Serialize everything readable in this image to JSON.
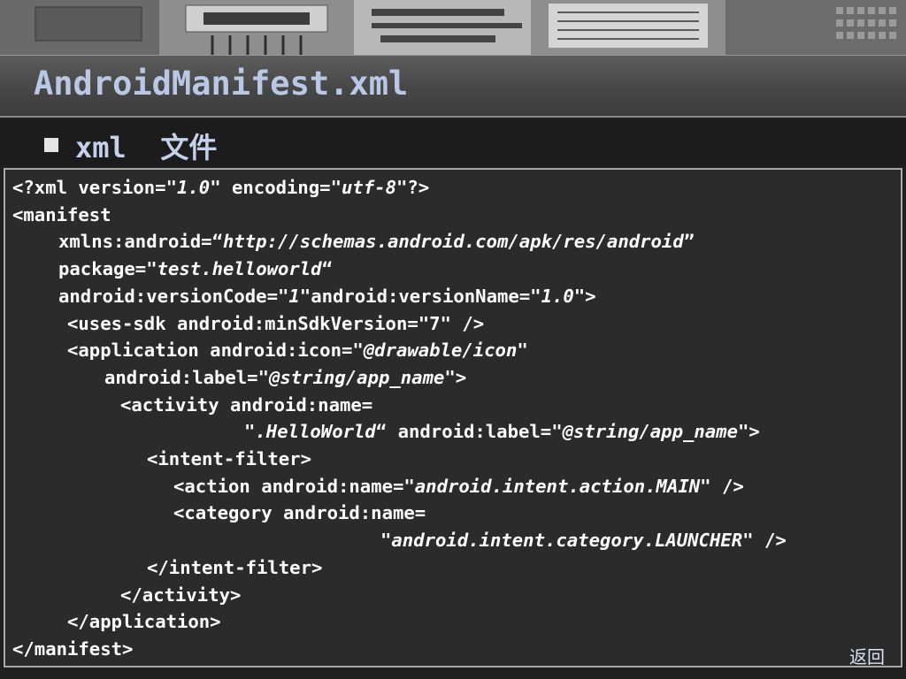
{
  "slide": {
    "title": "AndroidManifest.xml",
    "bullet": "xml  文件",
    "return_link": "返回"
  },
  "code_lines": [
    {
      "indent": 0,
      "parts": [
        [
          "<?xml version=",
          false
        ],
        [
          "\"1.0\"",
          true
        ],
        [
          " encoding=",
          false
        ],
        [
          "\"utf-8\"",
          true
        ],
        [
          "?>",
          false
        ]
      ]
    },
    {
      "indent": 0,
      "parts": [
        [
          "<manifest",
          false
        ]
      ]
    },
    {
      "indent": 52,
      "parts": [
        [
          "xmlns:android=“",
          false
        ],
        [
          "http://schemas.android.com/apk/res/android",
          true
        ],
        [
          "”",
          false
        ]
      ]
    },
    {
      "indent": 52,
      "parts": [
        [
          "package=",
          false
        ],
        [
          "\"test.helloworld",
          true
        ],
        [
          "“",
          false
        ]
      ]
    },
    {
      "indent": 52,
      "parts": [
        [
          "android:versionCode=",
          false
        ],
        [
          "\"1\"",
          true
        ],
        [
          "android:versionName=",
          false
        ],
        [
          "\"1.0\"",
          true
        ],
        [
          ">",
          false
        ]
      ]
    },
    {
      "indent": 62,
      "parts": [
        [
          "<uses-sdk android:minSdkVersion=\"7\" />",
          false
        ]
      ]
    },
    {
      "indent": 62,
      "parts": [
        [
          "<application android:icon=",
          false
        ],
        [
          "\"@drawable/icon\"",
          true
        ]
      ]
    },
    {
      "indent": 104,
      "parts": [
        [
          "android:label=",
          false
        ],
        [
          "\"@string/app_name\"",
          true
        ],
        [
          ">",
          false
        ]
      ]
    },
    {
      "indent": 122,
      "parts": [
        [
          "<activity android:name=",
          false
        ]
      ]
    },
    {
      "indent": 262,
      "parts": [
        [
          "\".HelloWorld",
          true
        ],
        [
          "“ android:label=",
          false
        ],
        [
          "\"@string/app_name\"",
          true
        ],
        [
          ">",
          false
        ]
      ]
    },
    {
      "indent": 152,
      "parts": [
        [
          "<intent-filter>",
          false
        ]
      ]
    },
    {
      "indent": 182,
      "parts": [
        [
          "<action android:name=",
          false
        ],
        [
          "\"android.intent.action.MAIN\"",
          true
        ],
        [
          " />",
          false
        ]
      ]
    },
    {
      "indent": 182,
      "parts": [
        [
          "<category android:name=",
          false
        ]
      ]
    },
    {
      "indent": 416,
      "parts": [
        [
          "\"android.intent.category.LAUNCHER\"",
          true
        ],
        [
          " />",
          false
        ]
      ]
    },
    {
      "indent": 152,
      "parts": [
        [
          "</intent-filter>",
          false
        ]
      ]
    },
    {
      "indent": 122,
      "parts": [
        [
          "</activity>",
          false
        ]
      ]
    },
    {
      "indent": 62,
      "parts": [
        [
          "</application>",
          false
        ]
      ]
    },
    {
      "indent": 0,
      "parts": [
        [
          "</manifest>",
          false
        ]
      ]
    }
  ]
}
